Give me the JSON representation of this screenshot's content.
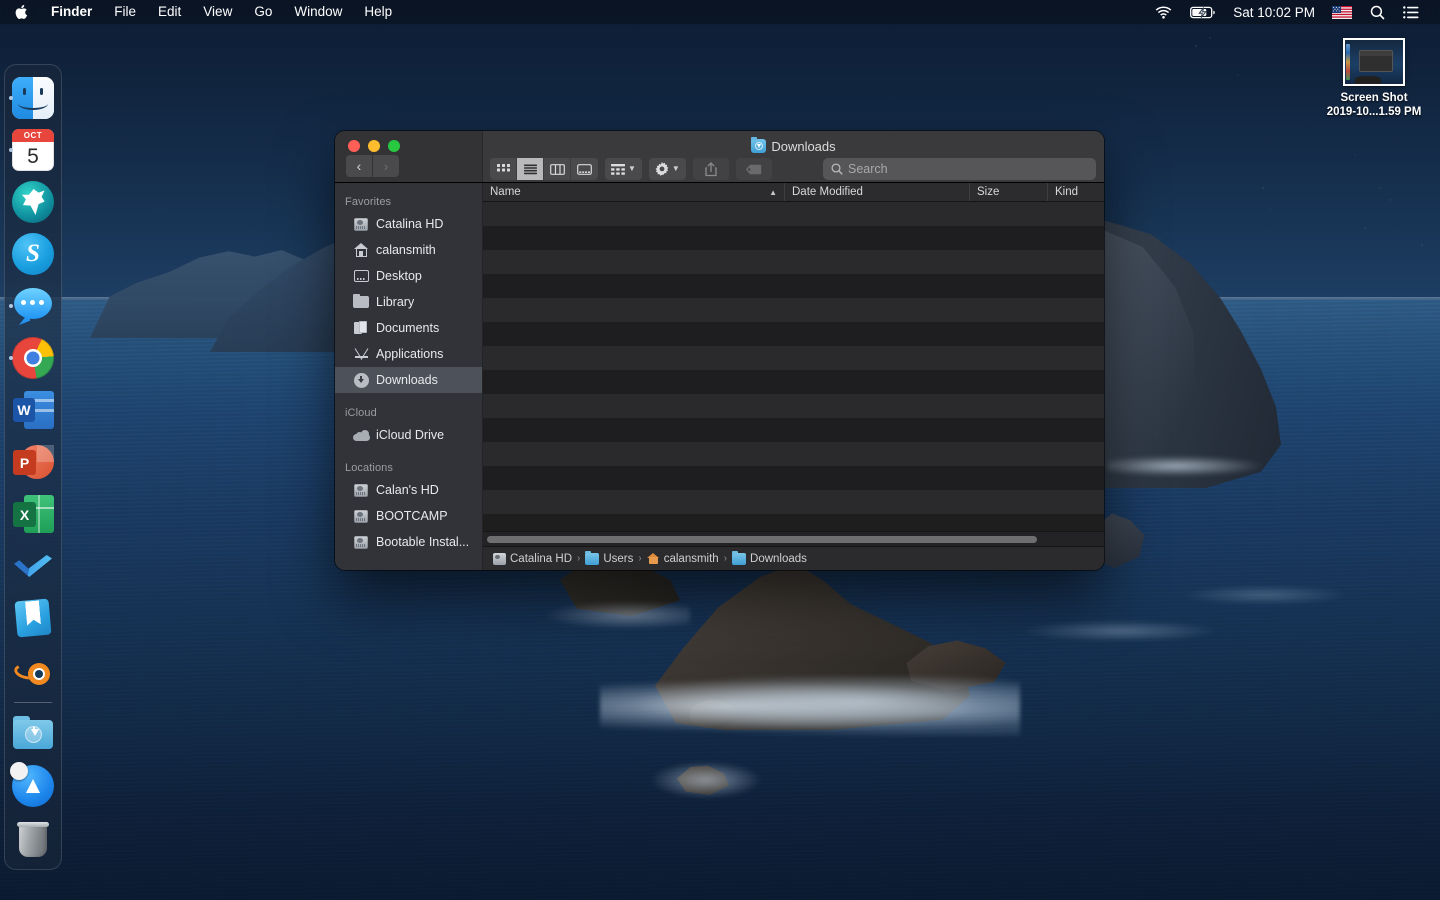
{
  "menubar": {
    "apple_icon": "apple-logo-icon",
    "items": [
      "Finder",
      "File",
      "Edit",
      "View",
      "Go",
      "Window",
      "Help"
    ],
    "status": {
      "wifi_icon": "wifi-icon",
      "battery_icon": "battery-charging-icon",
      "clock": "Sat 10:02 PM",
      "flag_icon": "us-flag-icon",
      "search_icon": "spotlight-search-icon",
      "control_center_icon": "control-center-icon"
    }
  },
  "desktop": {
    "icon": {
      "name": "screen-shot-file",
      "label_line1": "Screen Shot",
      "label_line2": "2019-10...1.59 PM"
    }
  },
  "dock": {
    "items": [
      {
        "name": "finder",
        "label": "Finder",
        "running": true
      },
      {
        "name": "calendar",
        "label": "Calendar",
        "running": true,
        "month": "OCT",
        "day": "5"
      },
      {
        "name": "goat-app",
        "label": "GoatApp",
        "running": false
      },
      {
        "name": "skype",
        "label": "Skype",
        "running": false,
        "glyph": "S"
      },
      {
        "name": "messages",
        "label": "Messages",
        "running": true
      },
      {
        "name": "google-chrome",
        "label": "Google Chrome",
        "running": true
      },
      {
        "name": "word",
        "label": "Microsoft Word",
        "running": false,
        "glyph": "W"
      },
      {
        "name": "powerpoint",
        "label": "Microsoft PowerPoint",
        "running": false,
        "glyph": "P"
      },
      {
        "name": "excel",
        "label": "Microsoft Excel",
        "running": false,
        "glyph": "X"
      },
      {
        "name": "todo-check",
        "label": "Things",
        "running": false
      },
      {
        "name": "books",
        "label": "Books",
        "running": false
      },
      {
        "name": "blender",
        "label": "Blender",
        "running": false
      }
    ],
    "bottom_items": [
      {
        "name": "downloads-folder",
        "label": "Downloads"
      },
      {
        "name": "app-store",
        "label": "App Store"
      },
      {
        "name": "trash",
        "label": "Trash"
      }
    ]
  },
  "finder": {
    "title": "Downloads",
    "title_icon": "downloads-folder-icon",
    "traffic_lights": {
      "close": "#ff5f57",
      "minimize": "#febc2e",
      "maximize": "#28c840"
    },
    "nav": {
      "back": "back-icon",
      "forward": "forward-icon",
      "forward_enabled": false
    },
    "view_modes": [
      {
        "name": "icon-view",
        "active": false
      },
      {
        "name": "list-view",
        "active": true
      },
      {
        "name": "column-view",
        "active": false
      },
      {
        "name": "gallery-view",
        "active": false
      }
    ],
    "toolbar_buttons": [
      {
        "name": "group-by-button",
        "icon": "grid-icon",
        "has_chevron": true,
        "enabled": true
      },
      {
        "name": "action-button",
        "icon": "gear-icon",
        "has_chevron": true,
        "enabled": true
      },
      {
        "name": "share-button",
        "icon": "share-icon",
        "has_chevron": false,
        "enabled": false
      },
      {
        "name": "tag-button",
        "icon": "tag-icon",
        "has_chevron": false,
        "enabled": false
      }
    ],
    "search": {
      "placeholder": "Search",
      "value": "",
      "icon": "search-icon"
    },
    "sidebar": {
      "sections": [
        {
          "heading": "Favorites",
          "items": [
            {
              "label": "Catalina HD",
              "icon": "hard-drive-icon",
              "selected": false
            },
            {
              "label": "calansmith",
              "icon": "home-icon",
              "selected": false
            },
            {
              "label": "Desktop",
              "icon": "desktop-icon",
              "selected": false
            },
            {
              "label": "Library",
              "icon": "folder-icon",
              "selected": false
            },
            {
              "label": "Documents",
              "icon": "documents-icon",
              "selected": false
            },
            {
              "label": "Applications",
              "icon": "applications-icon",
              "selected": false
            },
            {
              "label": "Downloads",
              "icon": "downloads-icon",
              "selected": true
            }
          ]
        },
        {
          "heading": "iCloud",
          "items": [
            {
              "label": "iCloud Drive",
              "icon": "cloud-icon",
              "selected": false
            }
          ]
        },
        {
          "heading": "Locations",
          "items": [
            {
              "label": "Calan's HD",
              "icon": "hard-drive-icon",
              "selected": false
            },
            {
              "label": "BOOTCAMP",
              "icon": "hard-drive-icon",
              "selected": false
            },
            {
              "label": "Bootable Instal...",
              "icon": "hard-drive-icon",
              "selected": false
            }
          ]
        }
      ]
    },
    "columns": [
      {
        "label": "Name",
        "sorted": true,
        "sort_direction": "ascending"
      },
      {
        "label": "Date Modified",
        "sorted": false,
        "sort_direction": ""
      },
      {
        "label": "Size",
        "sorted": false,
        "sort_direction": ""
      },
      {
        "label": "Kind",
        "sorted": false,
        "sort_direction": ""
      }
    ],
    "files": [],
    "empty_row_count": 13,
    "path_bar": [
      {
        "label": "Catalina HD",
        "icon": "hard-drive-icon"
      },
      {
        "label": "Users",
        "icon": "blue-folder-icon"
      },
      {
        "label": "calansmith",
        "icon": "home-folder-icon"
      },
      {
        "label": "Downloads",
        "icon": "downloads-folder-icon"
      }
    ],
    "path_separator": "›"
  }
}
